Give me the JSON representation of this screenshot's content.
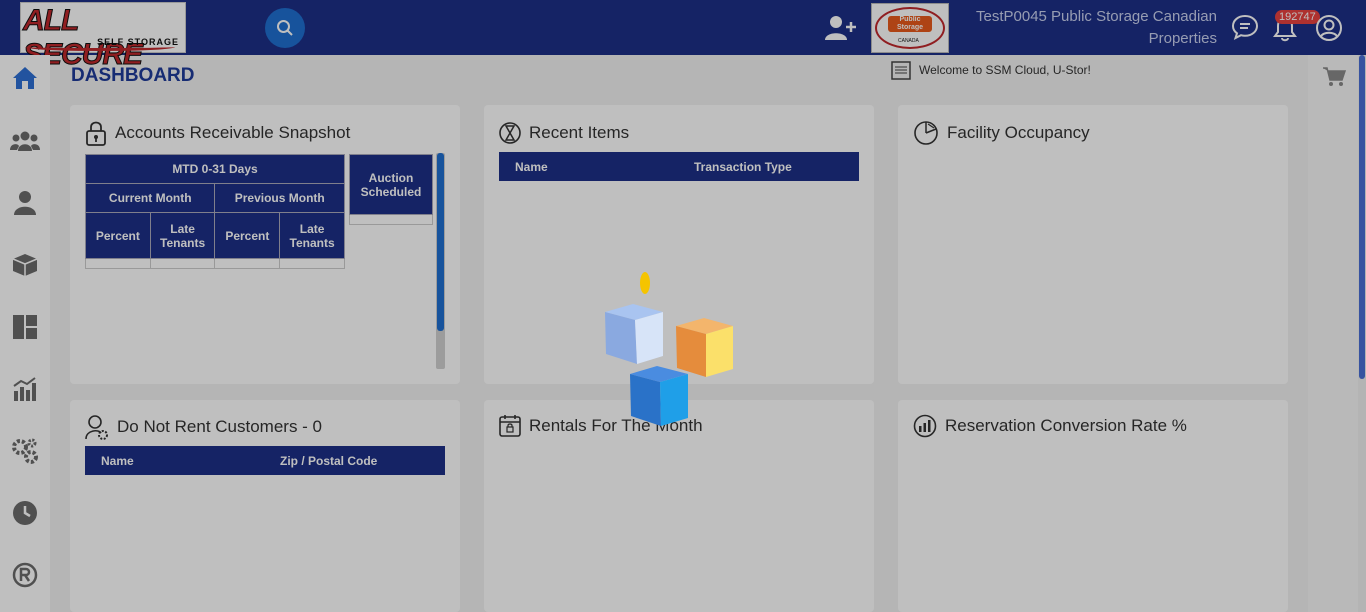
{
  "header": {
    "logo_main": "ALL SECURE",
    "logo_sub": "SELF STORAGE",
    "facility_logo_text": "Public Storage",
    "facility_logo_country": "CANADA",
    "facility_name": "TestP0045 Public Storage Canadian Properties",
    "notification_count": "192747",
    "icons": [
      "search-icon",
      "add-user-icon",
      "chat-icon",
      "bell-icon",
      "profile-icon"
    ]
  },
  "sidebar": {
    "items": [
      {
        "icon": "home-icon",
        "active": true
      },
      {
        "icon": "users-icon"
      },
      {
        "icon": "user-icon"
      },
      {
        "icon": "box-icon"
      },
      {
        "icon": "dashboard-icon"
      },
      {
        "icon": "chart-icon"
      },
      {
        "icon": "gears-icon"
      },
      {
        "icon": "clock-icon"
      },
      {
        "icon": "registered-icon"
      }
    ]
  },
  "page": {
    "title": "DASHBOARD",
    "welcome": "Welcome to SSM Cloud, U-Stor!"
  },
  "cards": {
    "ar": {
      "title": "Accounts Receivable Snapshot",
      "mtd": "MTD 0-31 Days",
      "current_month": "Current Month",
      "previous_month": "Previous Month",
      "percent": "Percent",
      "late_tenants": "Late Tenants",
      "auction": "Auction Scheduled"
    },
    "recent": {
      "title": "Recent Items",
      "col_name": "Name",
      "col_type": "Transaction Type"
    },
    "occupancy": {
      "title": "Facility Occupancy"
    },
    "dnr": {
      "title": "Do Not Rent Customers - 0",
      "col_name": "Name",
      "col_zip": "Zip / Postal Code"
    },
    "rentals": {
      "title": "Rentals For The Month"
    },
    "reservation": {
      "title": "Reservation Conversion Rate %"
    }
  },
  "colors": {
    "header_bg": "#1c2f87",
    "accent": "#1f6fd0",
    "badge": "#e8423f"
  }
}
